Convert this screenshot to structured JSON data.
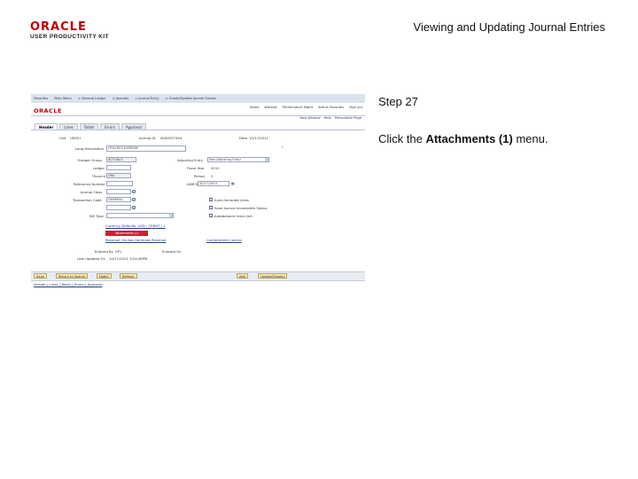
{
  "header": {
    "logo_oracle": "ORACLE",
    "logo_upk": "USER PRODUCTIVITY KIT",
    "title": "Viewing and Updating Journal Entries"
  },
  "step": {
    "label": "Step 27",
    "instruction_pre": "Click the ",
    "instruction_bold": "Attachments (1)",
    "instruction_post": " menu."
  },
  "screenshot": {
    "nav_items": [
      "Favorites",
      "Main Menu",
      "> General Ledger",
      "> Journals",
      "> Journal Entry",
      "> Create/Update Journal Entries"
    ],
    "brand": "ORACLE",
    "top_links": [
      "Home",
      "Worklist",
      "Performance Mgmt",
      "Add to Favorites",
      "Sign out"
    ],
    "page_links": [
      "New Window",
      "Help",
      "Personalize Page"
    ],
    "tabs": [
      "Header",
      "Lines",
      "Totals",
      "Errors",
      "Approval"
    ],
    "unit_label": "Unit",
    "unit_value": "US001",
    "journal_id_label": "Journal ID",
    "journal_id_value": "0000037494",
    "date_label": "Date",
    "date_value": "10/17/2011",
    "long_desc_label": "Long Description",
    "long_desc_value": "UTILITIES EXPENSE",
    "ledger_group_label": "*Ledger Group",
    "ledger_group_value": "ACTUALS",
    "ledger_label": "Ledger",
    "ledger_value": "",
    "source_label": "*Source",
    "source_value": "ONL",
    "adjusting_entry_label": "Adjusting Entry",
    "adjusting_entry_value": "Non-Adjusting Entry",
    "fiscal_year_label": "Fiscal Year",
    "fiscal_year_value": "2012",
    "period_label": "Period",
    "period_value": "2",
    "adb_date_label": "ADB Date",
    "adb_date_value": "10/17/2011",
    "reference_label": "Reference Number",
    "journal_class_label": "Journal Class",
    "transaction_code_label": "Transaction Code",
    "transaction_code_value": "GENERAL",
    "sjr_label": "SJE Type",
    "checkbox_labels": [
      "Auto Generate Lines",
      "Save Journal Incomplete Status",
      "Autobalance Intra Unit"
    ],
    "currency_link": "Currency Defaults: USD / CRRNT / 1",
    "red_button": "Attachments (1)",
    "reversal_link": "Reversal: Do Not Generate Reversal",
    "commitment_link": "Commitment Control",
    "entered_by_label": "Entered By",
    "entered_by_value": "VP1",
    "entered_on_label": "Entered On",
    "last_updated_label": "Last Updated On",
    "last_updated_value": "10/17/2011 3:24:48PM",
    "buttons": [
      "Save",
      "Return to Search",
      "Notify",
      "Refresh",
      "Add",
      "Update/Display"
    ],
    "footer_links": "Header | Lines | Totals | Errors | Approval"
  }
}
